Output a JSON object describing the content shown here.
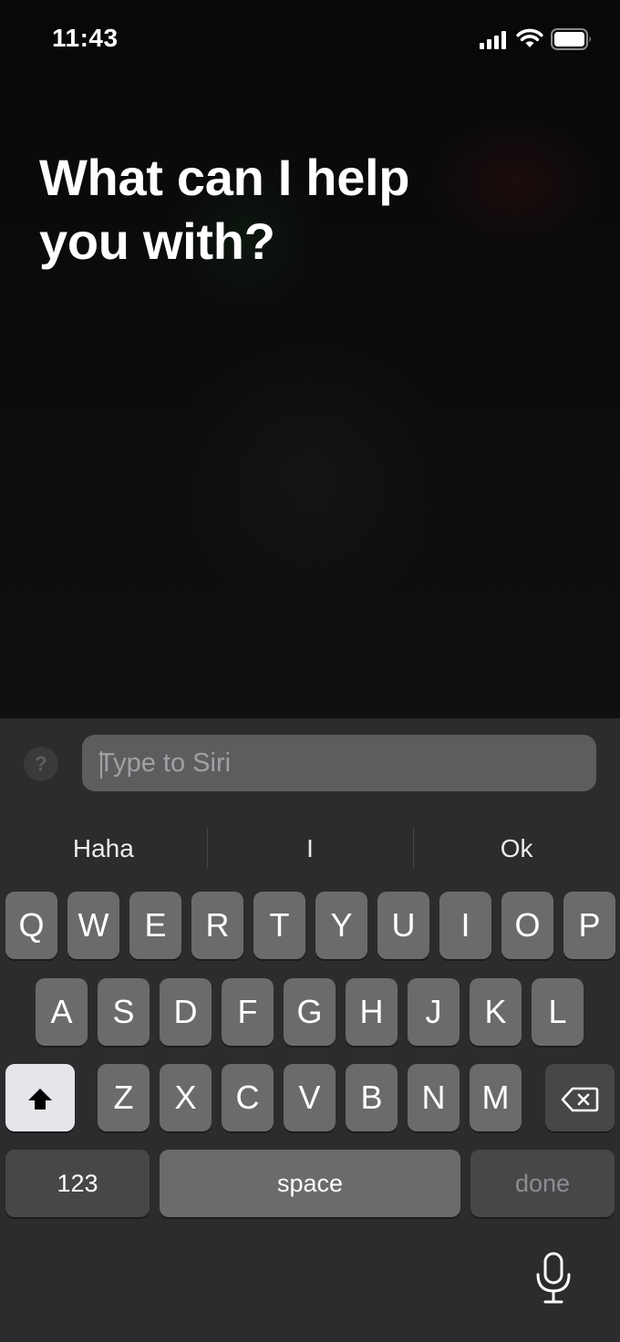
{
  "status_bar": {
    "time": "11:43",
    "icons": [
      "cellular-signal-icon",
      "wifi-icon",
      "battery-icon"
    ]
  },
  "prompt": "What can I help you with?",
  "input": {
    "placeholder": "Type to Siri",
    "value": ""
  },
  "help_button_label": "?",
  "suggestions": [
    "Haha",
    "I",
    "Ok"
  ],
  "keyboard": {
    "row1": [
      "Q",
      "W",
      "E",
      "R",
      "T",
      "Y",
      "U",
      "I",
      "O",
      "P"
    ],
    "row2": [
      "A",
      "S",
      "D",
      "F",
      "G",
      "H",
      "J",
      "K",
      "L"
    ],
    "row3": [
      "Z",
      "X",
      "C",
      "V",
      "B",
      "N",
      "M"
    ],
    "numbers_label": "123",
    "space_label": "space",
    "done_label": "done",
    "shift_icon": "shift-icon",
    "delete_icon": "delete-backspace-icon"
  },
  "mic_icon": "microphone-icon",
  "colors": {
    "keyboard_bg": "#2c2c2e",
    "key_bg": "#6b6b6d",
    "special_key_bg": "#47474a",
    "shift_active_bg": "#e5e5ea"
  }
}
